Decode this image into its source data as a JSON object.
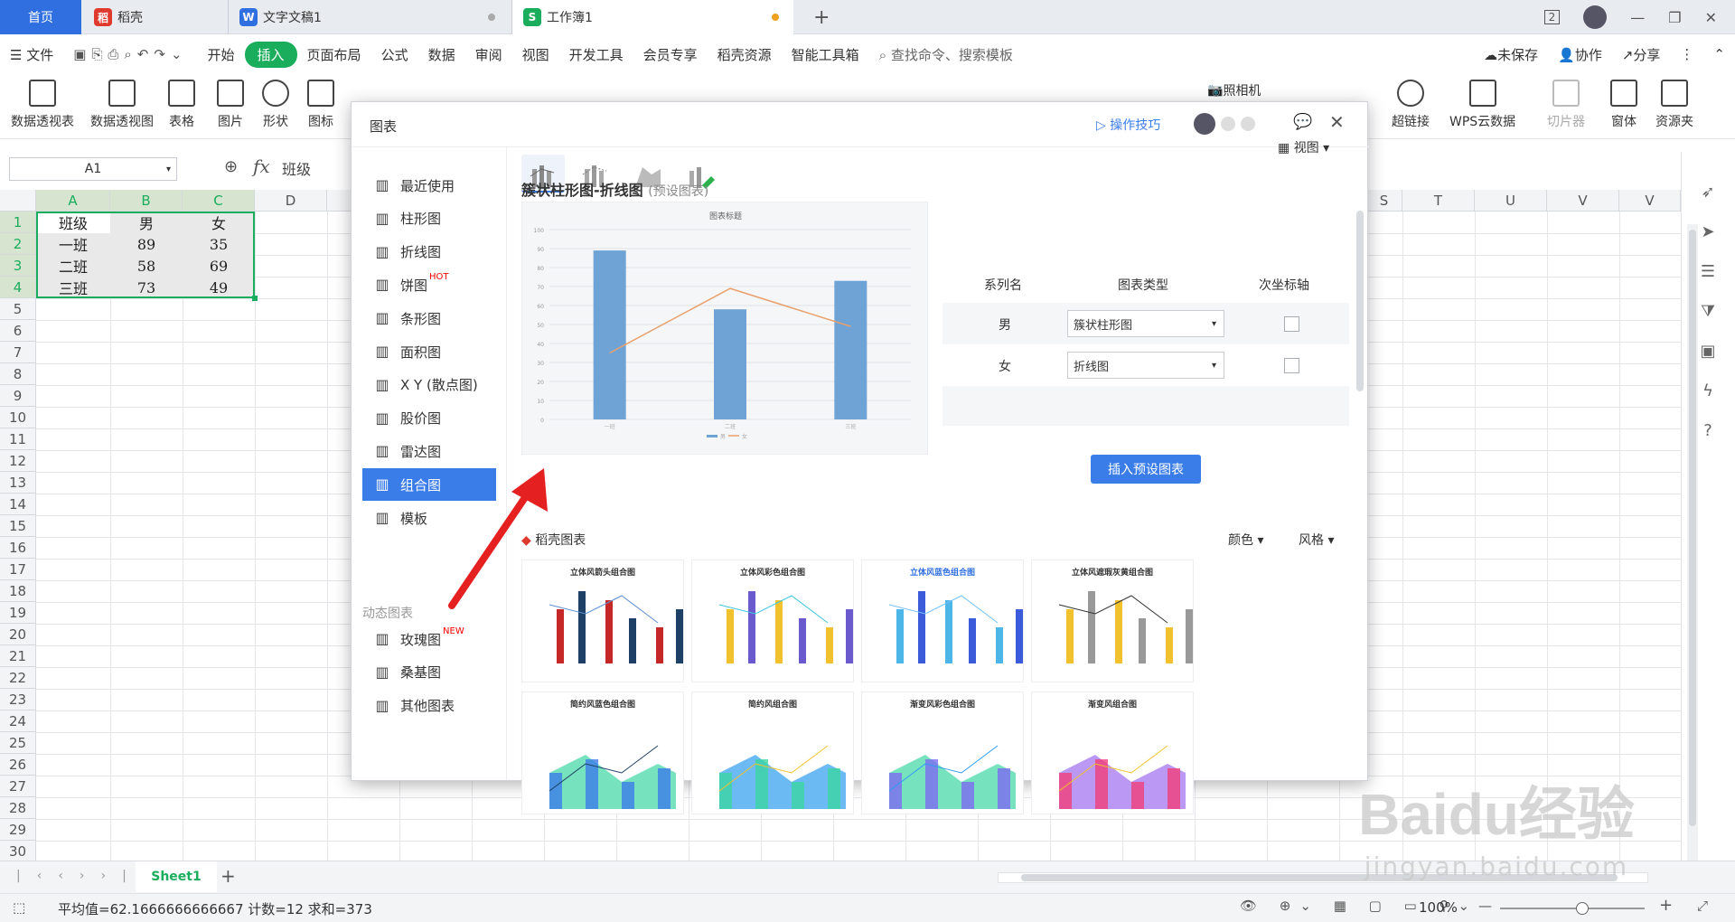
{
  "tabs": {
    "home": "首页",
    "daoke": "稻壳",
    "doc": "文字文稿1",
    "book": "工作簿1",
    "new": "+"
  },
  "window": {
    "badge": "2"
  },
  "menu": {
    "file": "文件",
    "items": [
      "开始",
      "插入",
      "页面布局",
      "公式",
      "数据",
      "审阅",
      "视图",
      "开发工具",
      "会员专享",
      "稻壳资源",
      "智能工具箱"
    ],
    "search": "查找命令、搜索模板",
    "unsaved": "未保存",
    "collab": "协作",
    "share": "分享"
  },
  "ribbon": {
    "items": [
      "数据透视表",
      "数据透视图",
      "表格",
      "图片",
      "形状",
      "图标"
    ],
    "right": [
      "超链接",
      "WPS云数据",
      "切片器",
      "窗体",
      "资源夹"
    ],
    "camera": "照相机"
  },
  "namebox": "A1",
  "formula": "班级",
  "columns": [
    "A",
    "B",
    "C",
    "D",
    "S",
    "T",
    "U",
    "V",
    "V"
  ],
  "rows": [
    "1",
    "2",
    "3",
    "4",
    "5",
    "6",
    "7",
    "8",
    "9",
    "10",
    "11",
    "12",
    "13",
    "14",
    "15",
    "16",
    "17",
    "18",
    "19",
    "20",
    "21",
    "22",
    "23",
    "24",
    "25",
    "26",
    "27",
    "28",
    "29",
    "30"
  ],
  "cells": [
    [
      "班级",
      "男",
      "女"
    ],
    [
      "一班",
      "89",
      "35"
    ],
    [
      "二班",
      "58",
      "69"
    ],
    [
      "三班",
      "73",
      "49"
    ]
  ],
  "dialog": {
    "title": "图表",
    "tips": "操作技巧",
    "nav": [
      {
        "label": "最近使用",
        "icon": "clock-icon"
      },
      {
        "label": "柱形图",
        "icon": "column-chart-icon"
      },
      {
        "label": "折线图",
        "icon": "line-chart-icon"
      },
      {
        "label": "饼图",
        "icon": "pie-chart-icon",
        "badge": "HOT"
      },
      {
        "label": "条形图",
        "icon": "bar-chart-icon"
      },
      {
        "label": "面积图",
        "icon": "area-chart-icon"
      },
      {
        "label": "X Y (散点图)",
        "icon": "scatter-chart-icon"
      },
      {
        "label": "股价图",
        "icon": "stock-chart-icon"
      },
      {
        "label": "雷达图",
        "icon": "radar-chart-icon"
      },
      {
        "label": "组合图",
        "icon": "combo-chart-icon"
      },
      {
        "label": "模板",
        "icon": "template-icon"
      }
    ],
    "dynamic_title": "动态图表",
    "dynamic_nav": [
      {
        "label": "玫瑰图",
        "icon": "rose-chart-icon",
        "badge": "NEW"
      },
      {
        "label": "桑基图",
        "icon": "sankey-chart-icon"
      },
      {
        "label": "其他图表",
        "icon": "other-chart-icon"
      }
    ],
    "view": "视图",
    "chart_name": "簇状柱形图-折线图",
    "chart_sub": "(预设图表)",
    "preview_title": "图表标题",
    "table_headers": [
      "系列名",
      "图表类型",
      "次坐标轴"
    ],
    "series_rows": [
      {
        "name": "男",
        "type": "簇状柱形图"
      },
      {
        "name": "女",
        "type": "折线图"
      }
    ],
    "insert_button": "插入预设图表",
    "daoke_charts": "稻壳图表",
    "color": "颜色",
    "style": "风格",
    "templates": [
      "立体风箭头组合图",
      "立体风彩色组合图",
      "立体风蓝色组合图",
      "立体风遮瑕灰黄组合图",
      "简约风蓝色组合图",
      "简约风组合图",
      "渐变风彩色组合图",
      "渐变风组合图"
    ]
  },
  "chart_data": {
    "type": "bar",
    "categories": [
      "一班",
      "二班",
      "三班"
    ],
    "series": [
      {
        "name": "男",
        "kind": "bar",
        "values": [
          89,
          58,
          73
        ]
      },
      {
        "name": "女",
        "kind": "line",
        "values": [
          35,
          69,
          49
        ]
      }
    ],
    "title": "图表标题",
    "ylim": [
      0,
      100
    ],
    "yticks": [
      0,
      10,
      20,
      30,
      40,
      50,
      60,
      70,
      80,
      90,
      100
    ],
    "colors": {
      "bar": "#6fa3d6",
      "line": "#e8a16d"
    },
    "grid": true,
    "legend": "bottom"
  },
  "sheet_tab": "Sheet1",
  "status": {
    "stats": "平均值=62.1666666666667 计数=12 求和=373",
    "zoom": "100%"
  },
  "watermark": {
    "main": "Baidu经验",
    "sub": "jingyan.baidu.com"
  }
}
